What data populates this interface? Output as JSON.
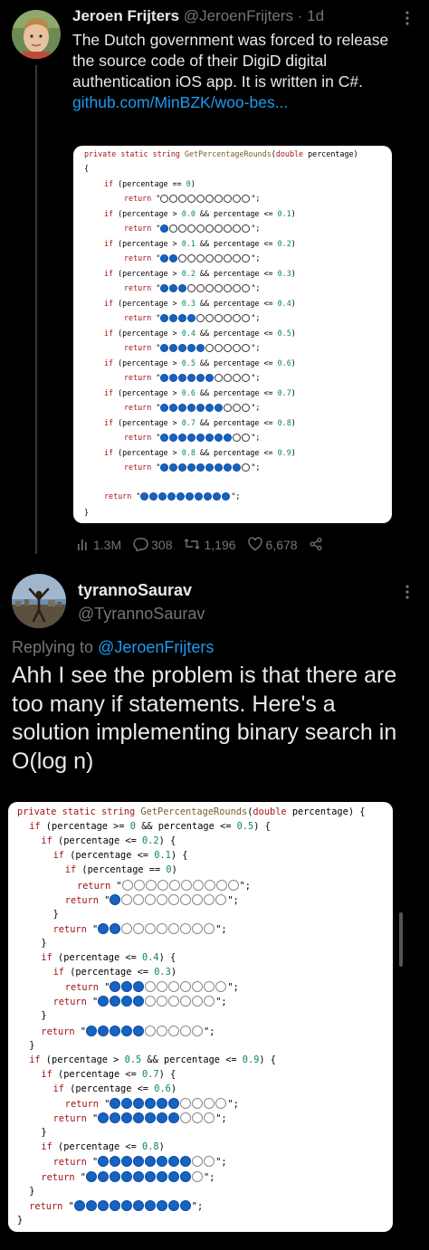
{
  "tweet1": {
    "display_name": "Jeroen Frijters",
    "handle": "@JeroenFrijters",
    "separator": "·",
    "time": "1d",
    "text": "The Dutch government was forced to release the source code of their DigiD digital authentication iOS app. It is written in C#.",
    "link": "github.com/MinBZK/woo-bes...",
    "code": {
      "signature": "private static string GetPercentageRounds(double percentage)",
      "open_brace": "{",
      "close_brace": "}",
      "rows": [
        {
          "cond": "if (percentage == 0)",
          "filled": 0
        },
        {
          "cond": "if (percentage > 0.0 && percentage <= 0.1)",
          "filled": 1
        },
        {
          "cond": "if (percentage > 0.1 && percentage <= 0.2)",
          "filled": 2
        },
        {
          "cond": "if (percentage > 0.2 && percentage <= 0.3)",
          "filled": 3
        },
        {
          "cond": "if (percentage > 0.3 && percentage <= 0.4)",
          "filled": 4
        },
        {
          "cond": "if (percentage > 0.4 && percentage <= 0.5)",
          "filled": 5
        },
        {
          "cond": "if (percentage > 0.5 && percentage <= 0.6)",
          "filled": 6
        },
        {
          "cond": "if (percentage > 0.6 && percentage <= 0.7)",
          "filled": 7
        },
        {
          "cond": "if (percentage > 0.7 && percentage <= 0.8)",
          "filled": 8
        },
        {
          "cond": "if (percentage > 0.8 && percentage <= 0.9)",
          "filled": 9
        }
      ],
      "final_return_filled": 10,
      "return_keyword": "return"
    },
    "stats": {
      "views": "1.3M",
      "replies": "308",
      "retweets": "1,196",
      "likes": "6,678"
    }
  },
  "tweet2": {
    "display_name": "tyrannoSaurav",
    "handle": "@TyrannoSaurav",
    "replying_prefix": "Replying to",
    "replying_to": "@JeroenFrijters",
    "text": "Ahh I see the problem is that there are too many if statements. Here's a solution implementing binary search in O(log n)",
    "code_lines": [
      {
        "indent": 0,
        "text": "private static string GetPercentageRounds(double percentage) {",
        "dots": null
      },
      {
        "indent": 1,
        "text": "if (percentage >= 0 && percentage <= 0.5) {",
        "dots": null
      },
      {
        "indent": 2,
        "text": "if (percentage <= 0.2) {",
        "dots": null
      },
      {
        "indent": 3,
        "text": "if (percentage <= 0.1) {",
        "dots": null
      },
      {
        "indent": 4,
        "text": "if (percentage == 0)",
        "dots": null
      },
      {
        "indent": 5,
        "text": "return",
        "dots": 0
      },
      {
        "indent": 4,
        "text": "return",
        "dots": 1
      },
      {
        "indent": 3,
        "text": "}",
        "dots": null
      },
      {
        "indent": 3,
        "text": "return",
        "dots": 2
      },
      {
        "indent": 2,
        "text": "}",
        "dots": null
      },
      {
        "indent": 2,
        "text": "if (percentage <= 0.4) {",
        "dots": null
      },
      {
        "indent": 3,
        "text": "if (percentage <= 0.3)",
        "dots": null
      },
      {
        "indent": 4,
        "text": "return",
        "dots": 3
      },
      {
        "indent": 3,
        "text": "return",
        "dots": 4
      },
      {
        "indent": 2,
        "text": "}",
        "dots": null
      },
      {
        "indent": 2,
        "text": "return",
        "dots": 5
      },
      {
        "indent": 1,
        "text": "}",
        "dots": null
      },
      {
        "indent": 1,
        "text": "if (percentage > 0.5 && percentage <= 0.9) {",
        "dots": null
      },
      {
        "indent": 2,
        "text": "if (percentage <= 0.7) {",
        "dots": null
      },
      {
        "indent": 3,
        "text": "if (percentage <= 0.6)",
        "dots": null
      },
      {
        "indent": 4,
        "text": "return",
        "dots": 6
      },
      {
        "indent": 3,
        "text": "return",
        "dots": 7
      },
      {
        "indent": 2,
        "text": "}",
        "dots": null
      },
      {
        "indent": 2,
        "text": "if (percentage <= 0.8)",
        "dots": null
      },
      {
        "indent": 3,
        "text": "return",
        "dots": 8
      },
      {
        "indent": 2,
        "text": "return",
        "dots": 9
      },
      {
        "indent": 1,
        "text": "}",
        "dots": null
      },
      {
        "indent": 1,
        "text": "return",
        "dots": 10
      },
      {
        "indent": 0,
        "text": "}",
        "dots": null
      }
    ]
  },
  "colors": {
    "background": "#000000",
    "text_primary": "#e7e9ea",
    "text_secondary": "#71767b",
    "link": "#1d9bf0",
    "dot_filled": "#1565c0"
  },
  "icons": [
    "more-icon",
    "views-icon",
    "reply-icon",
    "retweet-icon",
    "like-icon",
    "share-icon"
  ]
}
